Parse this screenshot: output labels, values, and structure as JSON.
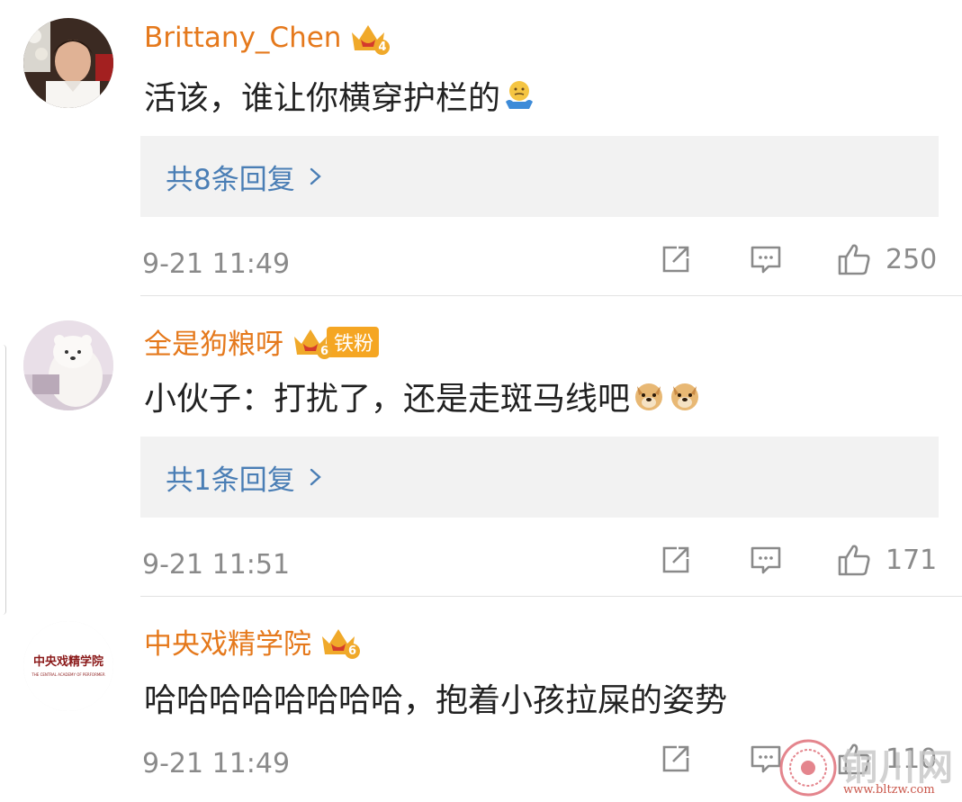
{
  "comments": [
    {
      "username": "Brittany_Chen",
      "vip_level": "4",
      "text": "活该，谁让你横穿护栏的",
      "emoji": "shrug-emoji",
      "reply_summary": "共8条回复",
      "timestamp": "9-21 11:49",
      "likes": "250"
    },
    {
      "username": "全是狗粮呀",
      "vip_level": "6",
      "badge": "铁粉",
      "text": "小伙子：打扰了，还是走斑马线吧",
      "emoji": "doge-emoji",
      "reply_summary": "共1条回复",
      "timestamp": "9-21 11:51",
      "likes": "171"
    },
    {
      "username": "中央戏精学院",
      "vip_level": "6",
      "avatar_text": "中央戏精学院",
      "avatar_subtext": "THE CENTRAL ACADEMY OF PERFORMER",
      "text": "哈哈哈哈哈哈哈哈，抱着小孩拉屎的姿势",
      "timestamp": "9-21 11:49",
      "likes": "110"
    }
  ],
  "watermark": {
    "title": "铜川网",
    "url": "www.bltzw.com"
  },
  "colors": {
    "username": "#e5791c",
    "reply_link": "#4a7eb5",
    "meta_text": "#8a8a8a",
    "reply_box_bg": "#f2f2f2",
    "vip_crown": "#f0a92a",
    "fan_badge": "#f5a623"
  },
  "icons": {
    "forward": "share-box-icon",
    "comment": "comment-bubble-icon",
    "like": "thumbs-up-icon",
    "chevron": "chevron-right-icon"
  }
}
